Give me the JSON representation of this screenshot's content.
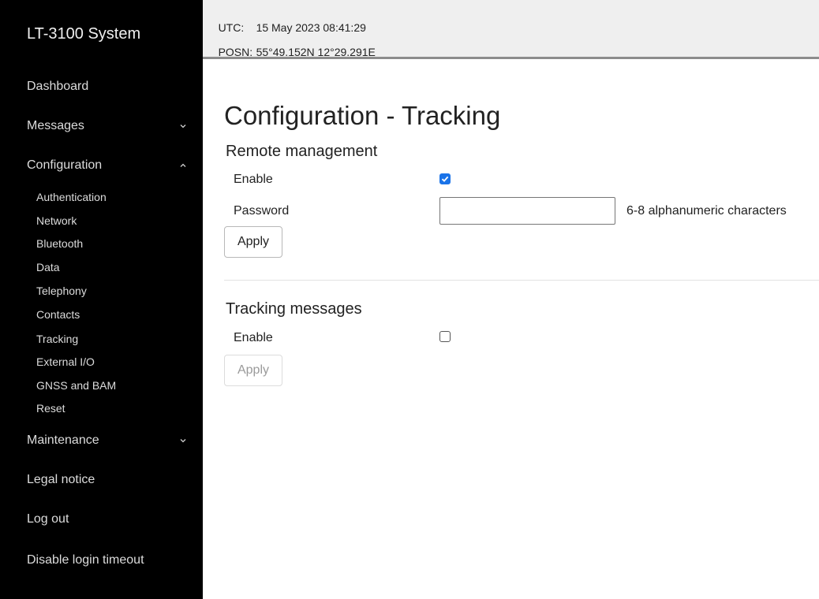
{
  "sidebar": {
    "brand": "LT-3100 System",
    "items": [
      {
        "label": "Dashboard"
      },
      {
        "label": "Messages"
      },
      {
        "label": "Configuration"
      },
      {
        "label": "Maintenance"
      },
      {
        "label": "Legal notice"
      },
      {
        "label": "Log out"
      },
      {
        "label": "Disable login timeout"
      }
    ],
    "config_subitems": [
      "Authentication",
      "Network",
      "Bluetooth",
      "Data",
      "Telephony",
      "Contacts",
      "Tracking",
      "External I/O",
      "GNSS and BAM",
      "Reset"
    ]
  },
  "header": {
    "utc_label": "UTC:",
    "utc_value": "15 May 2023 08:41:29",
    "posn_label": "POSN:",
    "posn_value": "55°49.152N 12°29.291E"
  },
  "main": {
    "title": "Configuration - Tracking",
    "remote": {
      "title": "Remote management",
      "enable_label": "Enable",
      "enable_checked": true,
      "password_label": "Password",
      "password_value": "",
      "password_hint": "6-8 alphanumeric characters",
      "apply_label": "Apply"
    },
    "tracking": {
      "title": "Tracking messages",
      "enable_label": "Enable",
      "enable_checked": false,
      "apply_label": "Apply",
      "apply_disabled": true
    }
  },
  "colors": {
    "sidebar_bg": "#000000",
    "header_bg": "#efefef",
    "checkbox_accent": "#1a73e8"
  }
}
